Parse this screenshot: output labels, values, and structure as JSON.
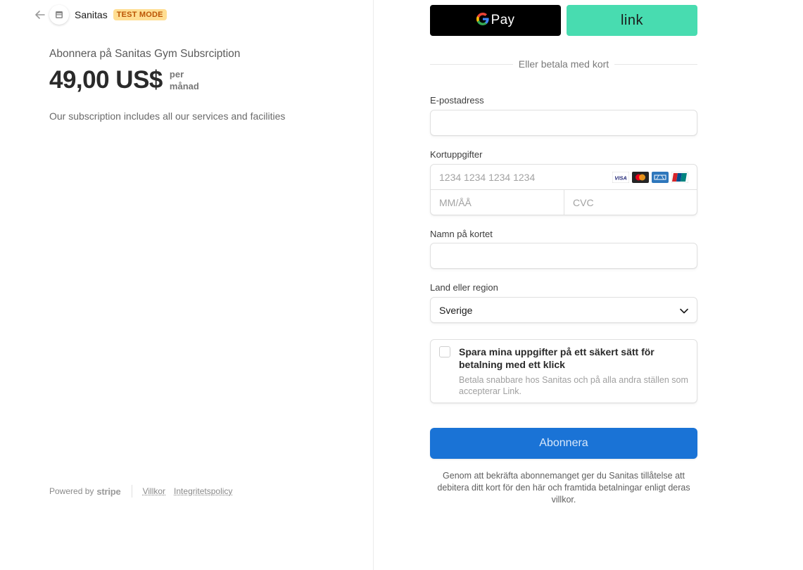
{
  "header": {
    "brand_name": "Sanitas",
    "test_badge": "TEST MODE"
  },
  "summary": {
    "title": "Abonnera på Sanitas Gym Subsrciption",
    "price": "49,00 US$",
    "period_line1": "per",
    "period_line2": "månad",
    "description": "Our subscription includes all our services and facilities"
  },
  "footer": {
    "powered_by": "Powered by",
    "stripe": "stripe",
    "terms_link": "Villkor",
    "privacy_link": "Integritetspolicy"
  },
  "payment": {
    "gpay_label": "Pay",
    "link_label": "link",
    "divider_text": "Eller betala med kort",
    "email_label": "E-postadress",
    "email_value": "",
    "card_label": "Kortuppgifter",
    "card_number_placeholder": "1234 1234 1234 1234",
    "expiry_placeholder": "MM/ÅÅ",
    "cvc_placeholder": "CVC",
    "card_brands": [
      "visa",
      "mastercard",
      "amex",
      "unionpay"
    ],
    "name_label": "Namn på kortet",
    "name_value": "",
    "country_label": "Land eller region",
    "country_value": "Sverige",
    "save_title": "Spara mina uppgifter på ett säkert sätt för betalning med ett klick",
    "save_sub": "Betala snabbare hos Sanitas och på alla andra ställen som accepterar Link.",
    "save_checked": false,
    "submit_label": "Abonnera",
    "terms_text": "Genom att bekräfta abonnemanget ger du Sanitas tillåtelse att debitera ditt kort för den här och framtida betalningar enligt deras villkor."
  },
  "colors": {
    "accent": "#1a73d6",
    "link_green": "#48dcb0",
    "badge_bg": "#ffde92",
    "badge_text": "#bb5504"
  }
}
